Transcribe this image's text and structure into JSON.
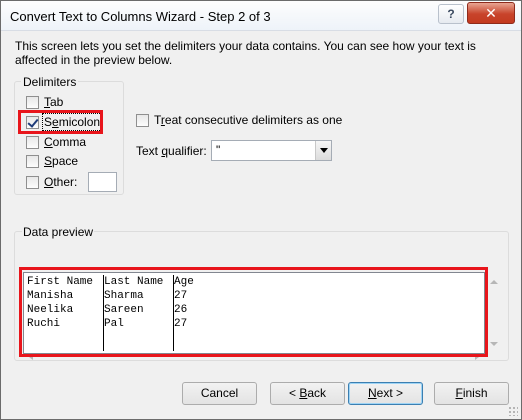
{
  "window": {
    "title": "Convert Text to Columns Wizard - Step 2 of 3",
    "help_label": "?",
    "close_label": "✕"
  },
  "description": "This screen lets you set the delimiters your data contains.  You can see how your text is affected in the preview below.",
  "delimiters": {
    "group_label": "Delimiters",
    "options": [
      {
        "label": "Tab",
        "checked": false
      },
      {
        "label": "Semicolon",
        "checked": true
      },
      {
        "label": "Comma",
        "checked": false
      },
      {
        "label": "Space",
        "checked": false
      },
      {
        "label": "Other:",
        "checked": false
      }
    ],
    "other_value": ""
  },
  "consecutive": {
    "label": "Treat consecutive delimiters as one",
    "checked": false
  },
  "qualifier": {
    "label": "Text qualifier:",
    "value": "\""
  },
  "preview": {
    "label": "Data preview",
    "rows": [
      [
        "First Name",
        "Last Name",
        "Age"
      ],
      [
        "Manisha",
        "Sharma",
        "27"
      ],
      [
        "Neelika",
        "Sareen",
        "26"
      ],
      [
        "Ruchi",
        "Pal",
        "27"
      ]
    ]
  },
  "buttons": {
    "cancel": "Cancel",
    "back": "< Back",
    "next": "Next >",
    "finish": "Finish"
  },
  "colors": {
    "highlight": "#e8151b",
    "dialog_bg": "#f0f0f0"
  }
}
